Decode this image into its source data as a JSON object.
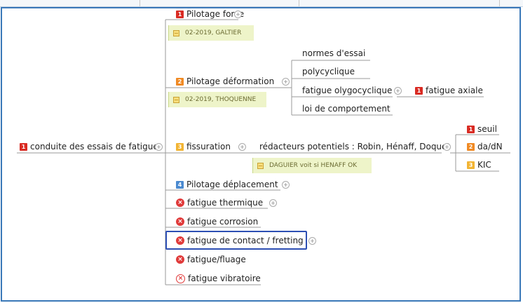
{
  "root": {
    "label": "conduite des essais de fatigue",
    "badge": "1"
  },
  "branches": {
    "pilotage_force": {
      "label": "Pilotage force",
      "badge": "1",
      "note": "02-2019, GALTIER"
    },
    "pilotage_deformation": {
      "label": "Pilotage déformation",
      "badge": "2",
      "note": "02-2019, THOQUENNE",
      "children": [
        "normes d'essai",
        "polycyclique",
        "fatigue olygocyclique",
        "loi de comportement"
      ],
      "sub": {
        "label": "fatigue axiale",
        "badge": "1"
      }
    },
    "fissuration": {
      "label": "fissuration",
      "badge": "3",
      "note": "DAGUIER voit si HENAFF OK",
      "child": "rédacteurs potentiels : Robin, Hénaff, Doquet",
      "leaves": [
        {
          "label": "seuil",
          "badge": "1"
        },
        {
          "label": "da/dN",
          "badge": "2"
        },
        {
          "label": "KIC",
          "badge": "3"
        }
      ]
    },
    "pilotage_deplacement": {
      "label": "Pilotage déplacement",
      "badge": "4"
    },
    "fatigue_thermique": {
      "label": "fatigue thermique"
    },
    "fatigue_corrosion": {
      "label": "fatigue corrosion"
    },
    "fatigue_contact": {
      "label": "fatigue de contact / fretting"
    },
    "fatigue_fluage": {
      "label": "fatigue/fluage"
    },
    "fatigue_vibratoire": {
      "label": "fatigue vibratoire"
    }
  },
  "colors": {
    "frame": "#3a78b8",
    "highlight": "#2d4fb3",
    "badge_red": "#d92b23",
    "badge_orange": "#f08a24",
    "badge_gold": "#f2b433",
    "badge_blue": "#4b8ad0",
    "note_bg": "#eef4c9"
  },
  "icons": {
    "collapse": "circle-plus-icon",
    "note": "note-icon",
    "cancel": "x-circle-icon"
  }
}
